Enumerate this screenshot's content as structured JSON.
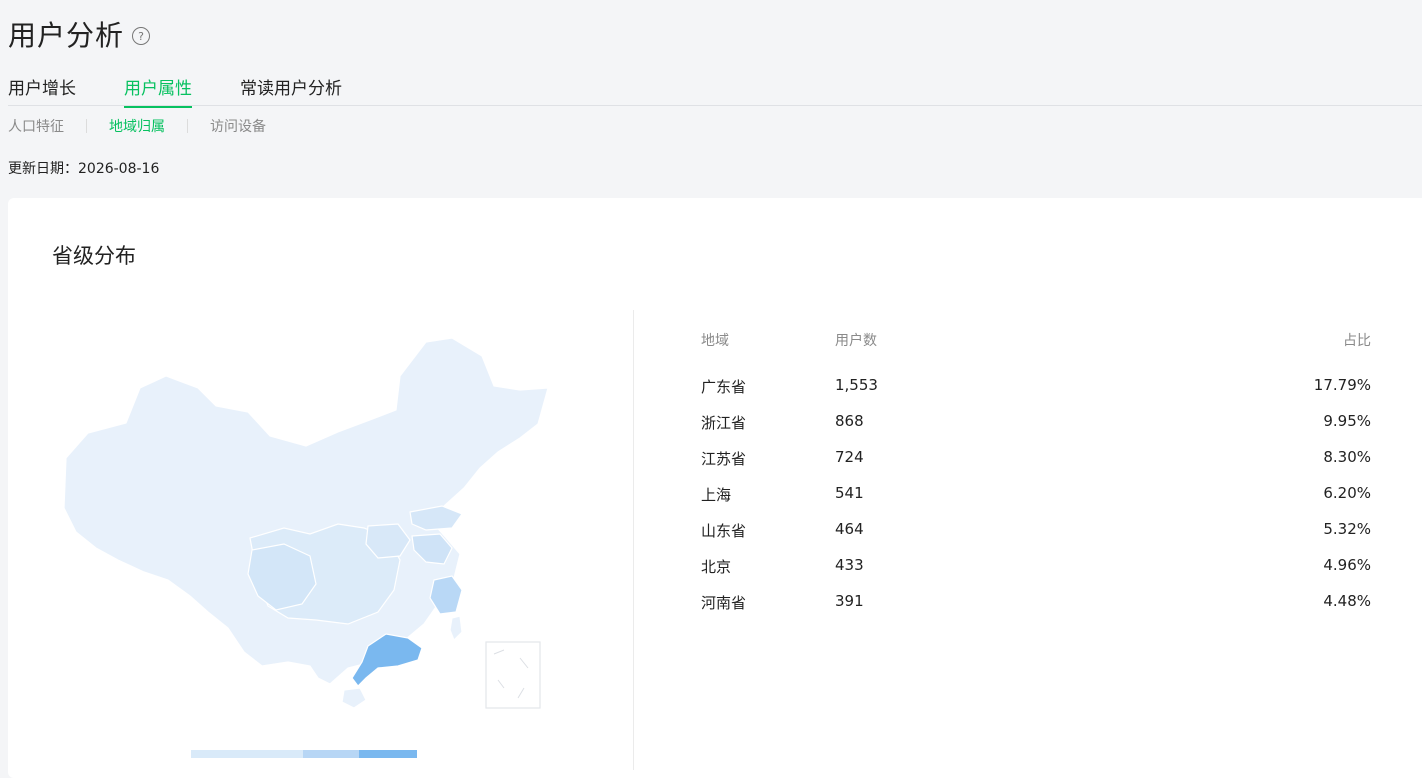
{
  "page": {
    "title": "用户分析",
    "help_icon": "?"
  },
  "tabs": [
    {
      "label": "用户增长",
      "active": false
    },
    {
      "label": "用户属性",
      "active": true
    },
    {
      "label": "常读用户分析",
      "active": false
    }
  ],
  "subtabs": [
    {
      "label": "人口特征",
      "active": false
    },
    {
      "label": "地域归属",
      "active": true
    },
    {
      "label": "访问设备",
      "active": false
    }
  ],
  "update": {
    "label": "更新日期：",
    "date": "2026-08-16"
  },
  "section": {
    "title": "省级分布"
  },
  "table": {
    "headers": {
      "region": "地域",
      "users": "用户数",
      "ratio": "占比"
    },
    "rows": [
      {
        "region": "广东省",
        "users": "1,553",
        "ratio": "17.79%"
      },
      {
        "region": "浙江省",
        "users": "868",
        "ratio": "9.95%"
      },
      {
        "region": "江苏省",
        "users": "724",
        "ratio": "8.30%"
      },
      {
        "region": "上海",
        "users": "541",
        "ratio": "6.20%"
      },
      {
        "region": "山东省",
        "users": "464",
        "ratio": "5.32%"
      },
      {
        "region": "北京",
        "users": "433",
        "ratio": "4.96%"
      },
      {
        "region": "河南省",
        "users": "391",
        "ratio": "4.48%"
      }
    ]
  },
  "colors": {
    "accent": "#07c160",
    "map_light": "#e6f0fa",
    "map_mid": "#cfe3f7",
    "map_high": "#7ab8ef"
  }
}
